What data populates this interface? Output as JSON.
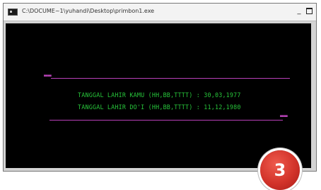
{
  "window": {
    "title": "C:\\DOCUME~1\\yuhandi\\Desktop\\primbon1.exe",
    "minimize_label": "_",
    "icon": "console-app-icon"
  },
  "console": {
    "decor_top": "▬▬",
    "decor_bottom": "▬▬",
    "lines": [
      "TANGGAL LAHIR KAMU (HH,BB,TTTT) : 30,03,1977",
      "TANGGAL LAHIR DO'I (HH,BB,TTTT) : 11,12,1980"
    ]
  },
  "badge": {
    "label": "3"
  },
  "colors": {
    "console_bg": "#000000",
    "console_text": "#27c43a",
    "rule": "#b840b8",
    "badge": "#d2332a"
  }
}
